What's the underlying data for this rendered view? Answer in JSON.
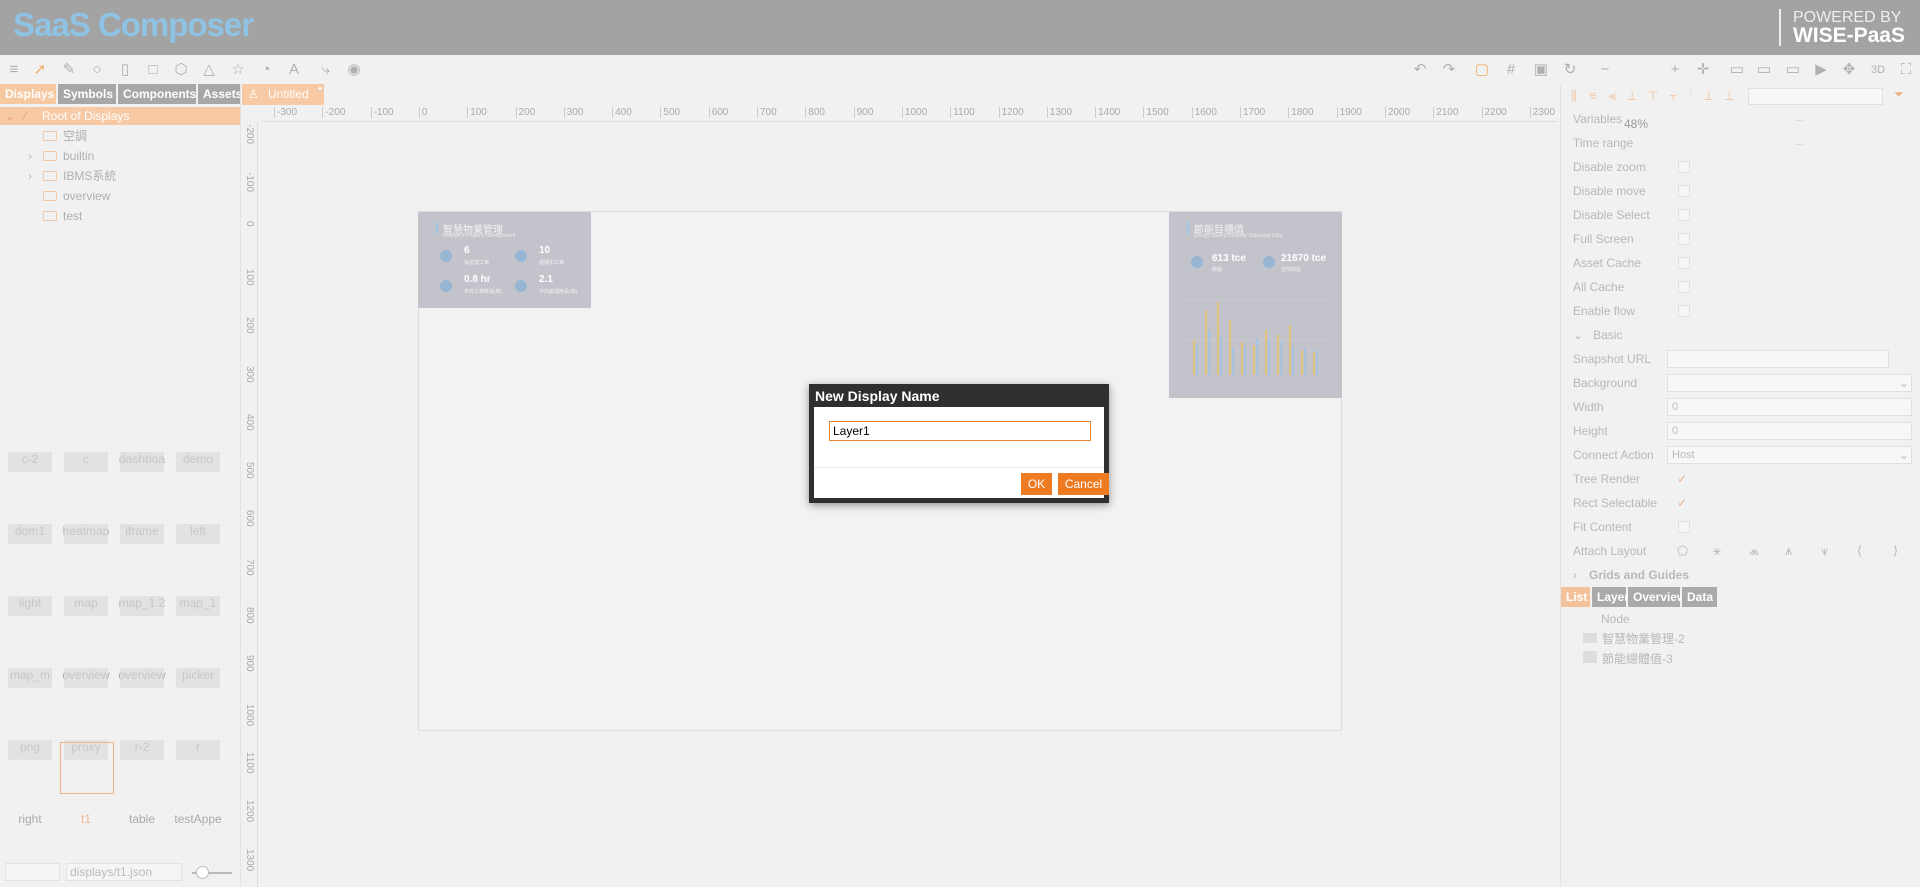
{
  "app": {
    "brand": "SaaS Composer",
    "powered_line1": "POWERED BY",
    "powered_line2": "WISE-PaaS"
  },
  "toolbar": {
    "zoom": "48%",
    "mode_3d": "3D"
  },
  "left_tabs": [
    "Displays",
    "Symbols",
    "Components",
    "Assets"
  ],
  "tree": {
    "root": "Root of Displays",
    "items": [
      "空調",
      "builtin",
      "IBMS系統",
      "overview",
      "test"
    ]
  },
  "thumbs": [
    "c-2",
    "c",
    "dashboa",
    "demo",
    "dom1",
    "heatmap",
    "iframe",
    "left",
    "light",
    "map",
    "map_1 2",
    "map_1",
    "map_m",
    "overview",
    "overview",
    "picker",
    "png",
    "proxy",
    "r-2",
    "r",
    "right",
    "t1",
    "table",
    "testAppe"
  ],
  "file_path": "displays/t1.json",
  "doc_tab": "Untitled",
  "ruler_h": [
    "-300",
    "-200",
    "-100",
    "0",
    "100",
    "200",
    "300",
    "400",
    "500",
    "600",
    "700",
    "800",
    "900",
    "1000",
    "1100",
    "1200",
    "1300",
    "1400",
    "1500",
    "1600",
    "1700",
    "1800",
    "1900",
    "2000",
    "2100",
    "2200",
    "2300"
  ],
  "ruler_v": [
    "-200",
    "-100",
    "0",
    "100",
    "200",
    "300",
    "400",
    "500",
    "600",
    "700",
    "800",
    "900",
    "1000",
    "1100",
    "1200",
    "1300"
  ],
  "card1": {
    "title": "智慧物業管理",
    "subtitle": "Intelligent Property Management",
    "s1": "6",
    "s1l": "祐處理工單",
    "s2": "10",
    "s2l": "處理中工單",
    "s3": "0.8 hr",
    "s3l": "平均工單時長(時)",
    "s4": "2.1",
    "s4l": "平均處理時長(時)"
  },
  "card2": {
    "title": "節能目標值",
    "subtitle": "Energy Saving Datarate Datarated Data",
    "s1": "613 tce",
    "s1l": "節能",
    "s2": "21670 tce",
    "s2l": "全球節能"
  },
  "dialog": {
    "title": "New Display Name",
    "value": "Layer1",
    "ok": "OK",
    "cancel": "Cancel"
  },
  "props": {
    "rows": [
      "Variables",
      "Time range",
      "Disable zoom",
      "Disable move",
      "Disable Select",
      "Full Screen",
      "Asset Cache",
      "All Cache",
      "Enable flow"
    ],
    "variables_val": "...",
    "timerange_val": "...",
    "section_basic": "Basic",
    "basic": [
      "Snapshot URL",
      "Background",
      "Width",
      "Height",
      "Connect Action",
      "Tree Render",
      "Rect Selectable",
      "Fit Content",
      "Attach Layout"
    ],
    "width_val": "0",
    "height_val": "0",
    "connect_val": "Host",
    "section_grids": "Grids and Guides",
    "tabs": [
      "List",
      "Layer",
      "Overview",
      "Data"
    ],
    "list": [
      "Node",
      "智慧物業管理-2",
      "節能總體值-3"
    ]
  }
}
